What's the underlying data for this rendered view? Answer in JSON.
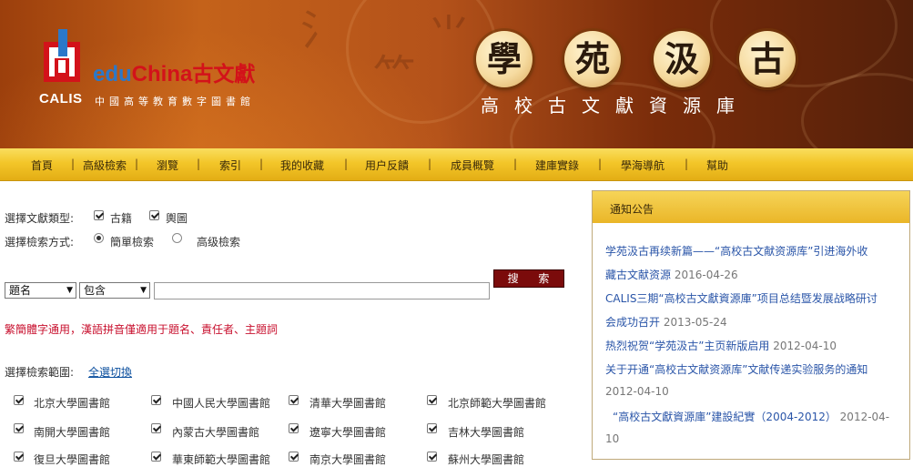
{
  "banner": {
    "brand_edu": "edu",
    "brand_china": "China",
    "brand_gwx": "古文獻",
    "calis": "CALIS",
    "subtitle": "中國高等教育數字圖書館",
    "seal_chars": [
      "學",
      "苑",
      "汲",
      "古"
    ],
    "tagline": "高校古文獻資源庫"
  },
  "nav": {
    "items": [
      "首頁",
      "高級檢索",
      "瀏覽",
      "索引",
      "我的收藏",
      "用户反饋",
      "成員概覽",
      "建庫實錄",
      "學海導航",
      "幫助"
    ],
    "separator": "|"
  },
  "form": {
    "doc_type_label": "選擇文獻類型:",
    "doc_types": [
      "古籍",
      "輿圖"
    ],
    "mode_label": "選擇檢索方式:",
    "modes": [
      "簡單檢索",
      "高级檢索"
    ],
    "selected_mode": "簡單檢索",
    "field_select": "題名",
    "match_select": "包含",
    "search_value": "",
    "search_button": "搜 索",
    "hint": "繁簡體字通用，漢語拼音僅適用于題名、責任者、主題詞",
    "scope_label": "選擇檢索範圍:",
    "toggle_all": "全選切換"
  },
  "libraries": [
    "北京大學圖書館",
    "中國人民大學圖書館",
    "清華大學圖書館",
    "北京師範大學圖書館",
    "南開大學圖書館",
    "內蒙古大學圖書館",
    "遼寧大學圖書館",
    "吉林大學圖書館",
    "復旦大學圖書館",
    "華東師範大學圖書館",
    "南京大學圖書館",
    "蘇州大學圖書館"
  ],
  "notice": {
    "title": "通知公告",
    "items": [
      {
        "line1": "学苑汲古再续新篇——“高校古文献资源库”引进海外收",
        "line2": "藏古文献资源",
        "date": "2016-04-26"
      },
      {
        "line1": "CALIS三期“高校古文獻資源庫”项目总结暨发展战略研讨",
        "line2": "会成功召开",
        "date": "2013-05-24"
      },
      {
        "line1": "热烈祝贺“学苑汲古”主页新版启用",
        "date": "2012-04-10"
      },
      {
        "line1": "关于开通“高校古文献资源库”文献传递实验服务的通知",
        "date": "2012-04-10"
      },
      {
        "line1": "“高校古文獻資源庫”建設紀實（2004-2012）",
        "date_part1": "2012-04-",
        "date_part2": "10"
      }
    ]
  },
  "colors": {
    "banner_dark": "#54200a",
    "banner_light": "#c4621a",
    "nav_gold": "#f3c629",
    "search_button": "#7b0b0b",
    "hint_red": "#c8102e",
    "link_blue": "#2a55a8"
  }
}
